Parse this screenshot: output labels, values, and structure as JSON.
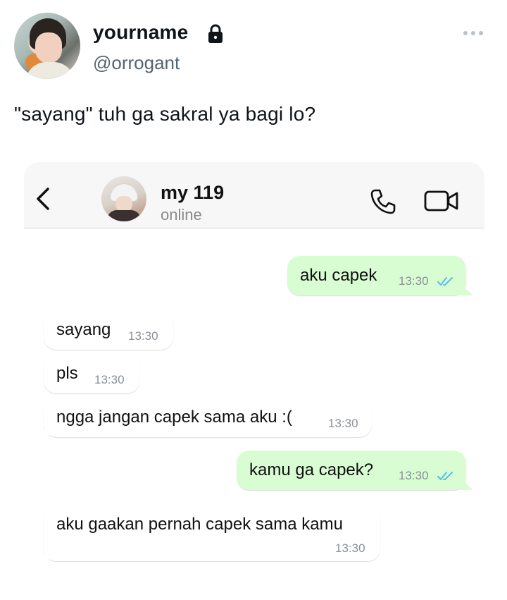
{
  "tweet": {
    "display_name": "yourname",
    "handle": "@orrogant",
    "text": "\"sayang\" tuh ga sakral ya bagi lo?"
  },
  "chat": {
    "contact_name": "my 119",
    "contact_status": "online",
    "messages": [
      {
        "direction": "out",
        "text": "aku capek",
        "time": "13:30",
        "read": true
      },
      {
        "direction": "in",
        "text": "sayang",
        "time": "13:30"
      },
      {
        "direction": "in",
        "text": "pls",
        "time": "13:30"
      },
      {
        "direction": "in",
        "text": "ngga jangan capek sama aku :(",
        "time": "13:30"
      },
      {
        "direction": "out",
        "text": "kamu ga capek?",
        "time": "13:30",
        "read": true
      },
      {
        "direction": "in",
        "text": "aku gaakan pernah capek sama kamu",
        "time": "13:30"
      }
    ]
  },
  "colors": {
    "outgoing_bubble": "#d9fdd3",
    "incoming_bubble": "#ffffff",
    "read_ticks": "#53bdeb"
  },
  "icons": [
    "lock-icon",
    "more-icon",
    "back-icon",
    "call-icon",
    "video-call-icon",
    "double-check-icon"
  ]
}
